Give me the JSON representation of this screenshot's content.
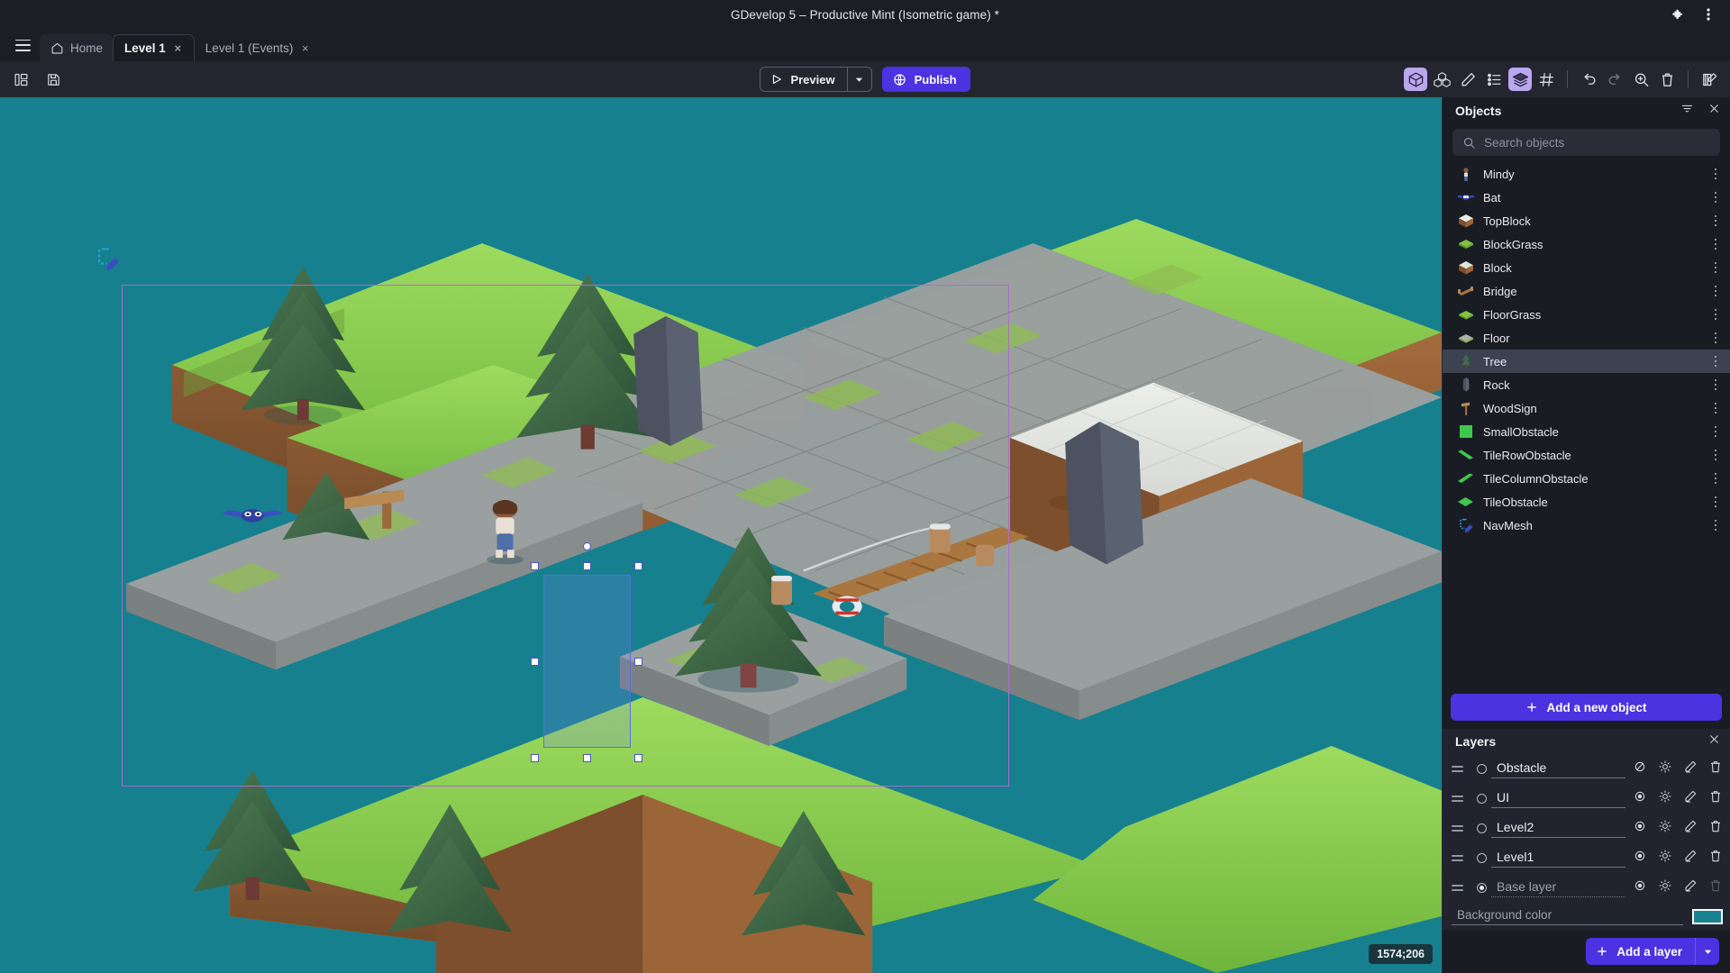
{
  "window": {
    "title": "GDevelop 5 – Productive Mint (Isometric game) *",
    "extensions_icon": "puzzle-icon",
    "menu_icon": "kebab-menu-icon"
  },
  "tabs": {
    "menu_icon": "hamburger-icon",
    "items": [
      {
        "label": "Home",
        "icon": "home-icon",
        "closable": false,
        "active": false
      },
      {
        "label": "Level 1",
        "icon": "",
        "closable": true,
        "active": true,
        "close_label": "×"
      },
      {
        "label": "Level 1 (Events)",
        "icon": "",
        "closable": true,
        "active": false,
        "close_label": "×"
      }
    ]
  },
  "toolbar": {
    "left_icons": [
      {
        "name": "panel-layout-icon"
      },
      {
        "name": "save-icon"
      }
    ],
    "preview_label": "Preview",
    "preview_icon": "play-icon",
    "preview_dropdown_icon": "chevron-down-icon",
    "publish_label": "Publish",
    "publish_icon": "globe-icon",
    "right_icons": [
      {
        "name": "object-3d-icon",
        "active": true
      },
      {
        "name": "instances-icon",
        "active": false
      },
      {
        "name": "edit-pencil-icon",
        "active": false
      },
      {
        "name": "properties-list-icon",
        "active": false
      },
      {
        "name": "layers-icon",
        "active": true
      },
      {
        "name": "grid-icon",
        "active": false
      },
      {
        "name": "undo-icon",
        "active": false
      },
      {
        "name": "redo-icon",
        "active": false
      },
      {
        "name": "zoom-in-icon",
        "active": false
      },
      {
        "name": "trash-icon",
        "active": false
      },
      {
        "name": "open-editor-icon",
        "active": false
      }
    ]
  },
  "canvas": {
    "background_color": "#16808f",
    "coordinates": "1574;206",
    "navmesh_marker": "navmesh-icon",
    "selected_object": "Tree"
  },
  "objects_panel": {
    "title": "Objects",
    "filter_icon": "filter-icon",
    "close_icon": "close-icon",
    "search": {
      "value": "",
      "placeholder": "Search objects",
      "icon": "search-icon"
    },
    "items": [
      {
        "name": "Mindy",
        "icon": "character-thumb",
        "selected": false
      },
      {
        "name": "Bat",
        "icon": "bat-thumb",
        "selected": false
      },
      {
        "name": "TopBlock",
        "icon": "topblock-thumb",
        "selected": false
      },
      {
        "name": "BlockGrass",
        "icon": "grassblock-thumb",
        "selected": false
      },
      {
        "name": "Block",
        "icon": "block-thumb",
        "selected": false
      },
      {
        "name": "Bridge",
        "icon": "bridge-thumb",
        "selected": false
      },
      {
        "name": "FloorGrass",
        "icon": "floorgrass-thumb",
        "selected": false
      },
      {
        "name": "Floor",
        "icon": "floor-thumb",
        "selected": false
      },
      {
        "name": "Tree",
        "icon": "tree-thumb",
        "selected": true
      },
      {
        "name": "Rock",
        "icon": "rock-thumb",
        "selected": false
      },
      {
        "name": "WoodSign",
        "icon": "woodsign-thumb",
        "selected": false
      },
      {
        "name": "SmallObstacle",
        "icon": "green-square-thumb",
        "selected": false
      },
      {
        "name": "TileRowObstacle",
        "icon": "green-row-thumb",
        "selected": false
      },
      {
        "name": "TileColumnObstacle",
        "icon": "green-col-thumb",
        "selected": false
      },
      {
        "name": "TileObstacle",
        "icon": "green-diamond-thumb",
        "selected": false
      },
      {
        "name": "NavMesh",
        "icon": "navmesh-thumb",
        "selected": false
      }
    ],
    "add_object_label": "Add a new object",
    "add_object_icon": "plus-icon"
  },
  "layers_panel": {
    "title": "Layers",
    "close_icon": "close-icon",
    "items": [
      {
        "name": "Obstacle",
        "active": false,
        "visible": false,
        "effects_icon": "effects-icon",
        "edit_icon": "pencil-icon",
        "delete_icon": "trash-icon",
        "deletable": true
      },
      {
        "name": "UI",
        "active": false,
        "visible": true,
        "effects_icon": "effects-icon",
        "edit_icon": "pencil-icon",
        "delete_icon": "trash-icon",
        "deletable": true
      },
      {
        "name": "Level2",
        "active": false,
        "visible": true,
        "effects_icon": "effects-icon",
        "edit_icon": "pencil-icon",
        "delete_icon": "trash-icon",
        "deletable": true
      },
      {
        "name": "Level1",
        "active": false,
        "visible": true,
        "effects_icon": "effects-icon",
        "edit_icon": "pencil-icon",
        "delete_icon": "trash-icon",
        "deletable": true
      },
      {
        "name": "Base layer",
        "active": true,
        "visible": true,
        "effects_icon": "effects-icon",
        "edit_icon": "pencil-icon",
        "delete_icon": "trash-icon",
        "deletable": false
      }
    ],
    "background_color_label": "Background color",
    "background_color_value": "#1a8191",
    "add_layer_label": "Add a layer",
    "add_layer_icon": "plus-icon",
    "add_layer_dropdown_icon": "chevron-down-icon"
  }
}
